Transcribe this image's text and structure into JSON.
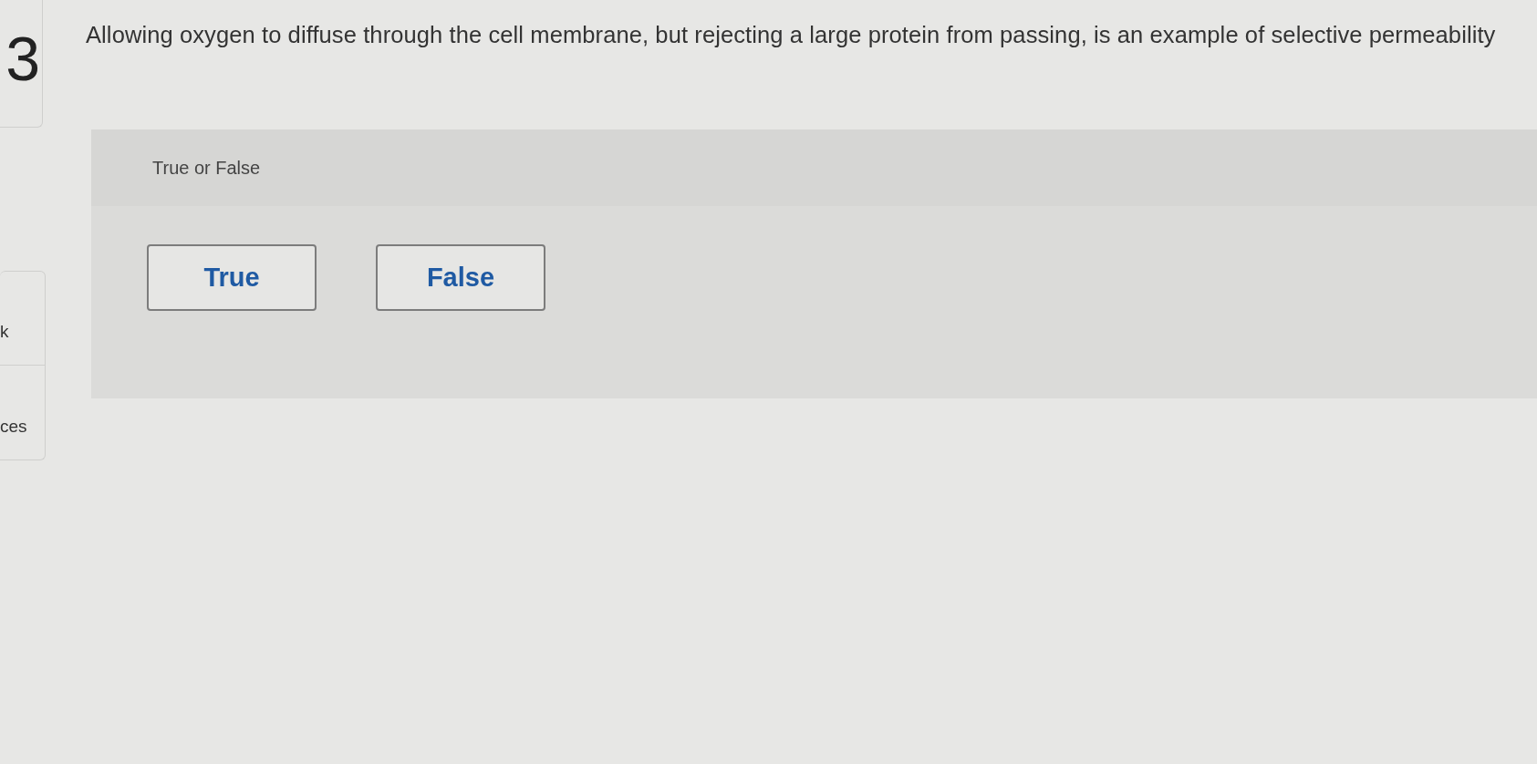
{
  "sidebar": {
    "question_number": "3",
    "items": [
      {
        "label": "k"
      },
      {
        "label": "ces"
      }
    ]
  },
  "question": {
    "prompt": "Allowing oxygen to diffuse through the cell membrane, but rejecting a large protein from passing, is an example of selective permeability",
    "type_label": "True or False",
    "options": [
      {
        "label": "True",
        "selected": false
      },
      {
        "label": "False",
        "selected": false
      }
    ]
  }
}
